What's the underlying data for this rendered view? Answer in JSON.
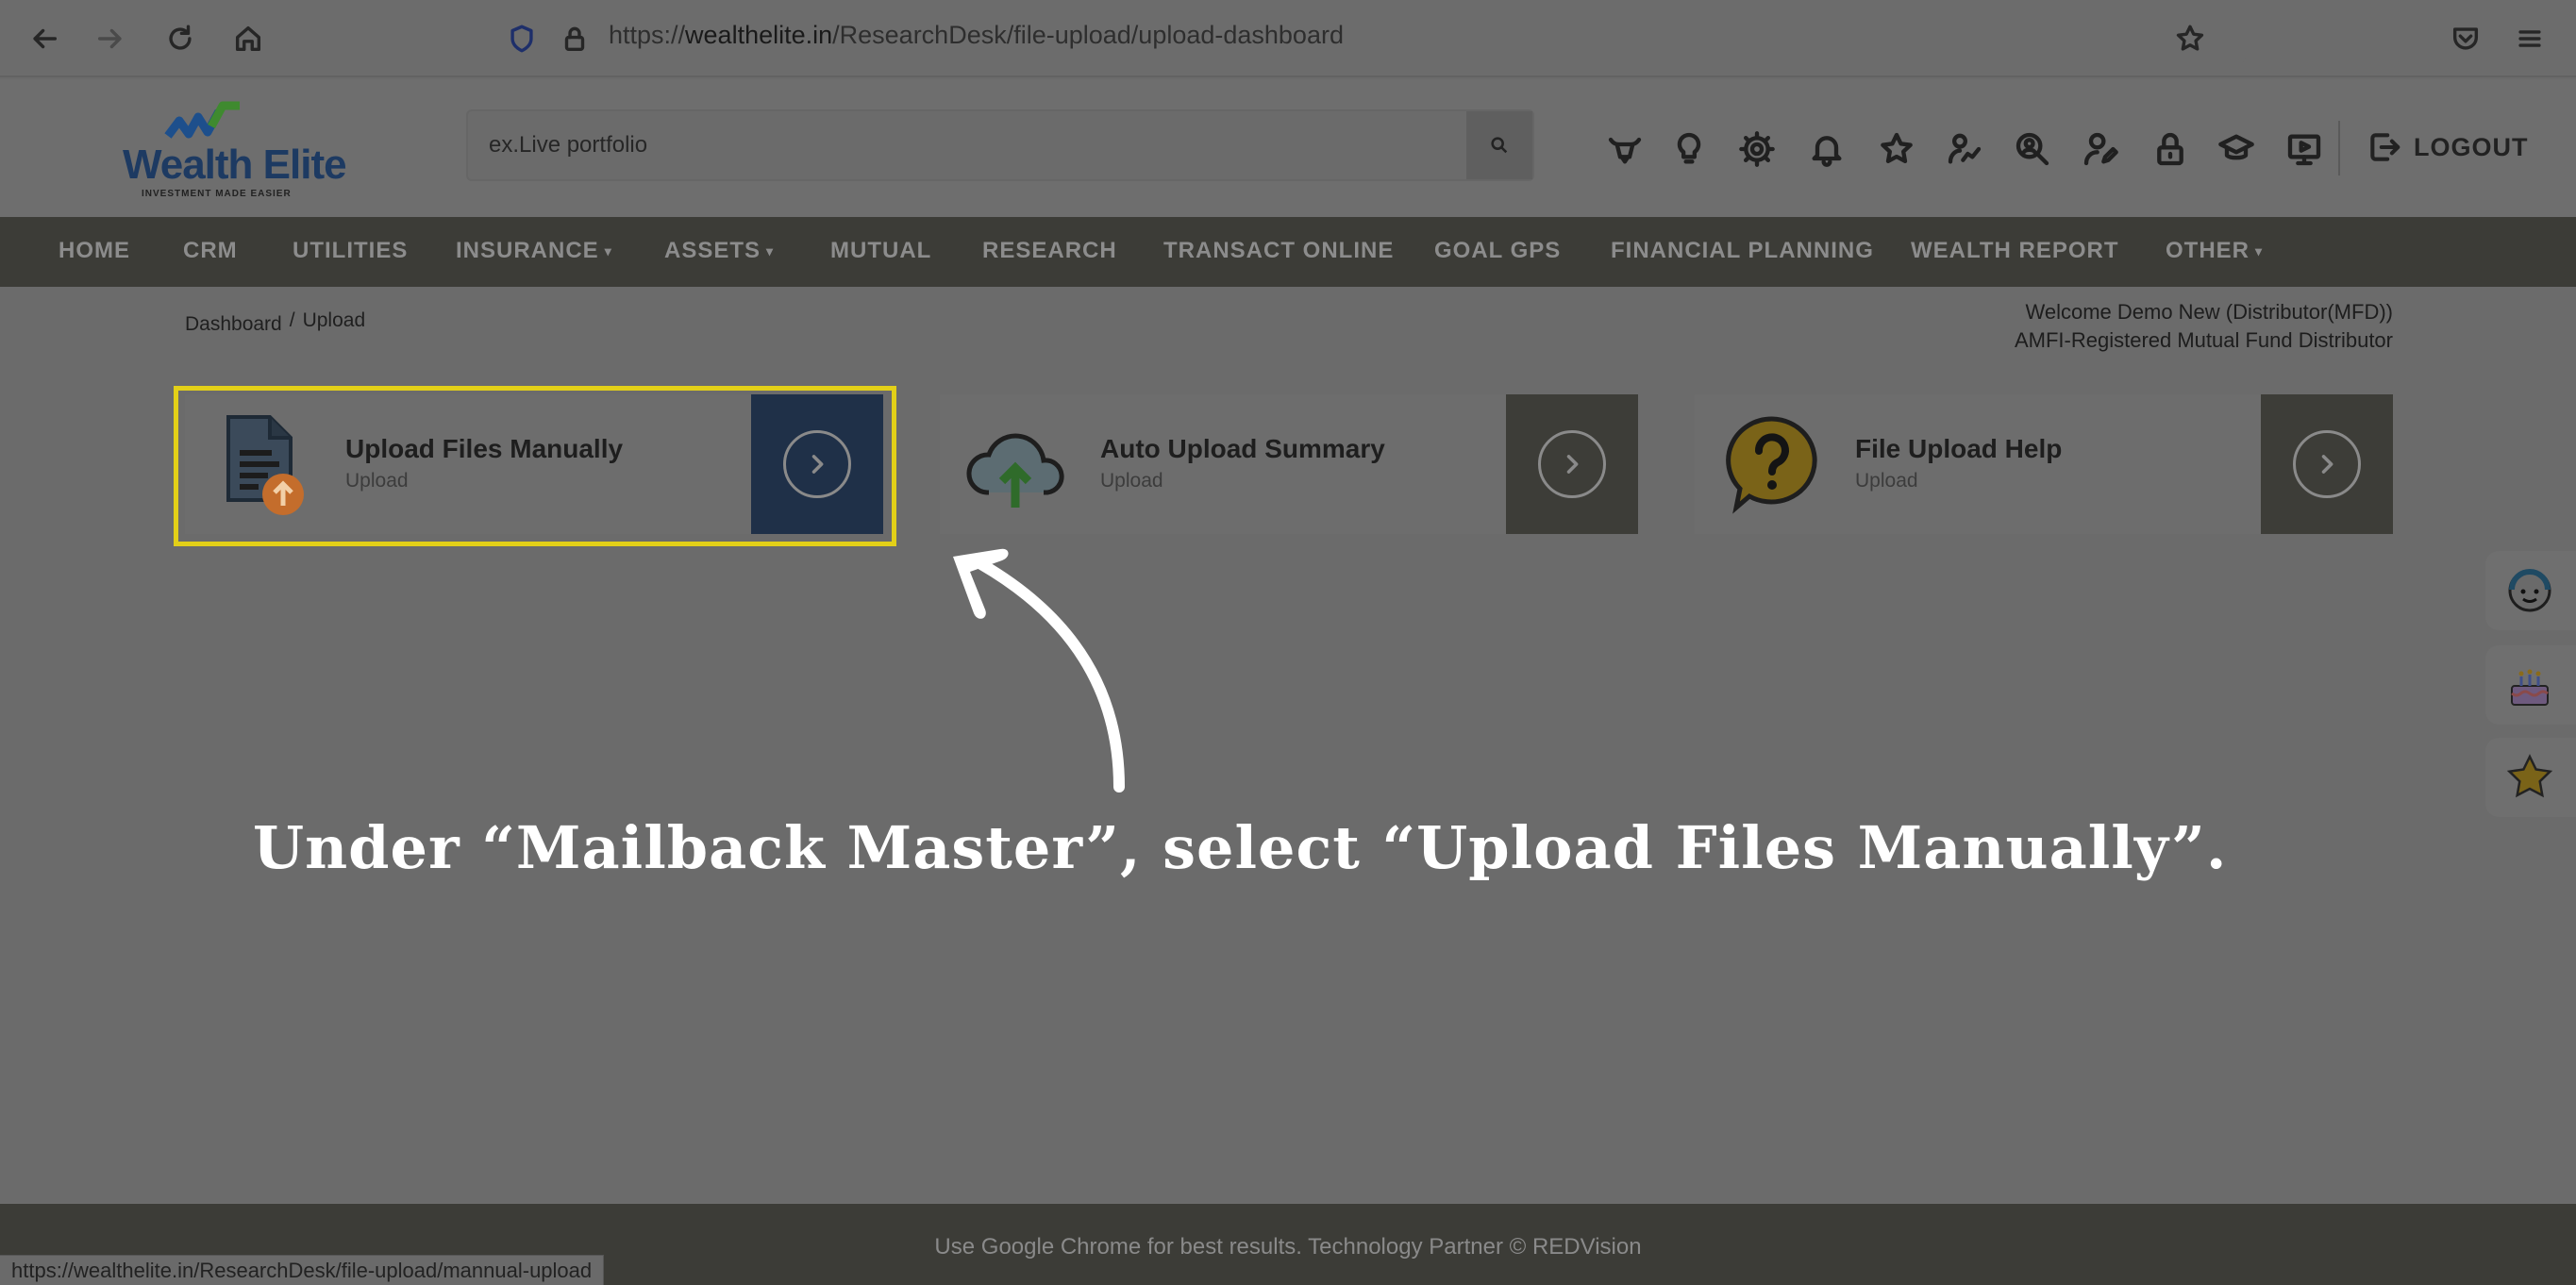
{
  "browser": {
    "url_prefix": "https://",
    "url_domain": "wealthelite.in",
    "url_path": "/ResearchDesk/file-upload/upload-dashboard"
  },
  "header": {
    "logo_text": "Wealth Elite",
    "logo_tagline": "INVESTMENT MADE EASIER",
    "search_placeholder": "ex.Live portfolio",
    "icons": [
      "bull-icon",
      "bulb-icon",
      "gear-icon",
      "bell-icon",
      "star-icon",
      "user-chart-icon",
      "search-user-icon",
      "user-edit-icon",
      "lock-icon",
      "graduation-cap-icon",
      "presentation-icon"
    ],
    "logout_label": "LOGOUT"
  },
  "nav": {
    "items": [
      {
        "label": "HOME",
        "dropdown": false
      },
      {
        "label": "CRM",
        "dropdown": false
      },
      {
        "label": "UTILITIES",
        "dropdown": false
      },
      {
        "label": "INSURANCE",
        "dropdown": true
      },
      {
        "label": "ASSETS",
        "dropdown": true
      },
      {
        "label": "MUTUAL",
        "dropdown": false
      },
      {
        "label": "RESEARCH",
        "dropdown": false
      },
      {
        "label": "TRANSACT ONLINE",
        "dropdown": false
      },
      {
        "label": "GOAL GPS",
        "dropdown": false
      },
      {
        "label": "FINANCIAL PLANNING",
        "dropdown": false
      },
      {
        "label": "WEALTH REPORT",
        "dropdown": false
      },
      {
        "label": "OTHER",
        "dropdown": true
      }
    ],
    "caret": "▾"
  },
  "breadcrumb": {
    "items": [
      "Dashboard",
      "Upload"
    ],
    "separator": "/"
  },
  "welcome": {
    "line1": "Welcome Demo New (Distributor(MFD))",
    "line2": "AMFI-Registered Mutual Fund Distributor"
  },
  "cards": [
    {
      "title": "Upload Files Manually",
      "subtitle": "Upload",
      "icon": "file-upload-icon",
      "highlighted": true
    },
    {
      "title": "Auto Upload Summary",
      "subtitle": "Upload",
      "icon": "cloud-upload-icon",
      "highlighted": false
    },
    {
      "title": "File Upload Help",
      "subtitle": "Upload",
      "icon": "question-bubble-icon",
      "highlighted": false
    }
  ],
  "annotation": {
    "caption": "Under “Mailback Master”, select  “Upload Files Manually”."
  },
  "side_widgets": [
    "support-agent-icon",
    "birthday-cake-icon",
    "star-icon"
  ],
  "footer": {
    "text": "Use Google Chrome for best results. Technology Partner © REDVision"
  },
  "status_bar": {
    "url": "https://wealthelite.in/ResearchDesk/file-upload/mannual-upload"
  },
  "colors": {
    "highlight": "#e3d018",
    "nav_bg": "#3c3c37",
    "active_card_arrow": "#1f3048",
    "caption": "#ffffff"
  }
}
